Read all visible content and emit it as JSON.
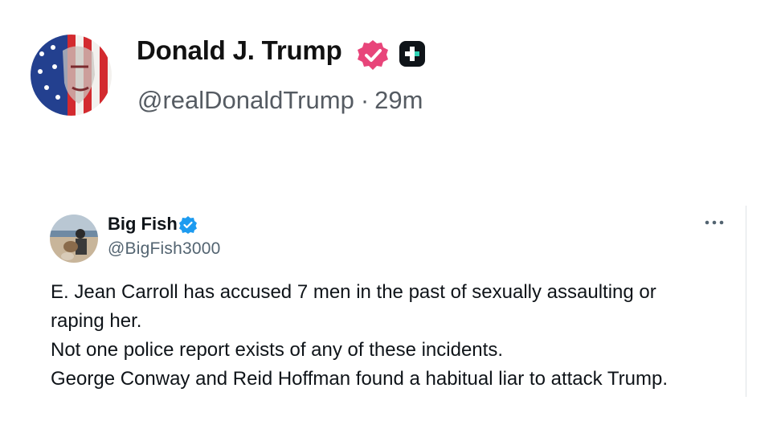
{
  "post": {
    "author": {
      "display_name": "Donald J. Trump",
      "handle": "@realDonaldTrump",
      "separator": "·",
      "time": "29m",
      "verified_icon": "verified-badge-icon",
      "badge_icon": "plus-badge-icon",
      "avatar_icon": "flag-portrait-avatar"
    }
  },
  "quoted_post": {
    "author": {
      "display_name": "Big Fish",
      "handle": "@BigFish3000",
      "verified_icon": "verified-check-icon",
      "avatar_icon": "beach-photo-avatar"
    },
    "menu_icon": "more-options-icon",
    "lines": [
      "E. Jean Carroll has accused 7 men in the past of sexually assaulting or",
      "raping her.",
      "Not one police report exists of any of these incidents.",
      "George Conway and Reid Hoffman found a habitual liar to attack Trump."
    ]
  },
  "colors": {
    "verified_pink": "#e8457a",
    "verified_blue": "#1d9bf0",
    "handle_gray": "#555b62",
    "quote_handle_gray": "#536471",
    "text": "#0f1419"
  }
}
